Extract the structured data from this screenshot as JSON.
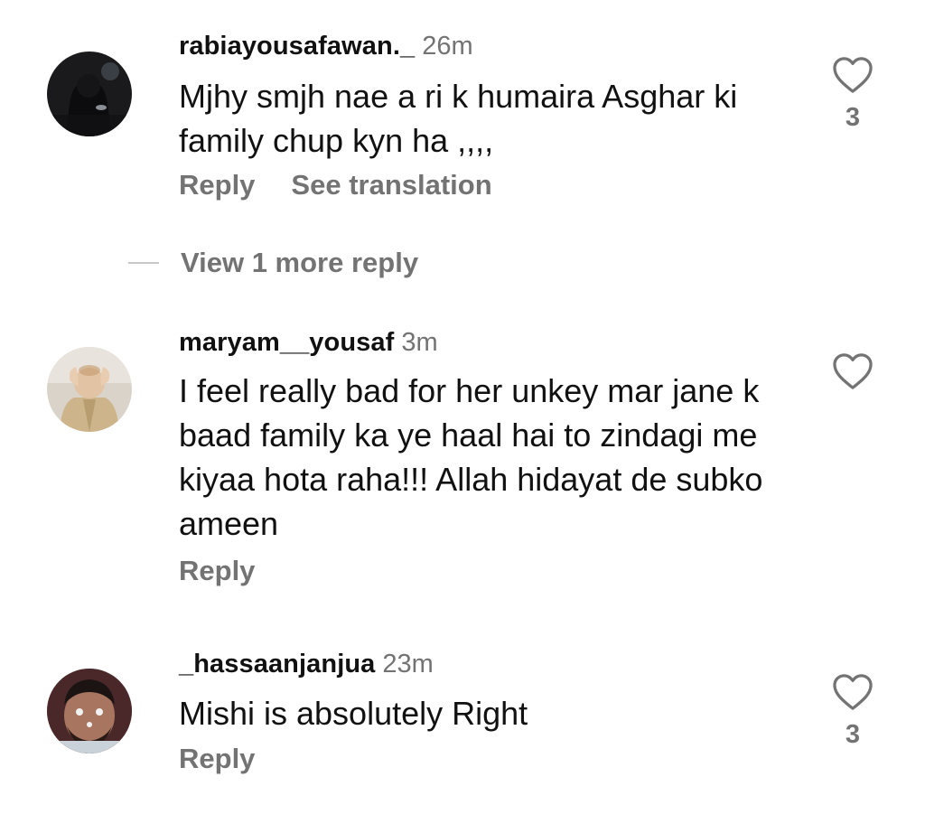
{
  "comments": [
    {
      "username": "rabiayousafawan._",
      "time": "26m",
      "text": "Mjhy smjh nae a ri k humaira Asghar ki family chup kyn ha ,,,,",
      "reply_label": "Reply",
      "translate_label": "See translation",
      "likes": "3"
    },
    {
      "username": "maryam__yousaf",
      "time": "3m",
      "text": "I feel really bad for her unkey mar jane k baad family ka ye haal hai to zindagi me kiyaa hota raha!!! Allah hidayat de subko ameen",
      "reply_label": "Reply"
    },
    {
      "username": "_hassaanjanjua",
      "time": "23m",
      "text": "Mishi is absolutely Right",
      "reply_label": "Reply",
      "likes": "3"
    }
  ],
  "view_replies_label": "View 1 more reply",
  "icons": {
    "like": "heart-outline-icon",
    "avatar": "avatar-photo"
  },
  "colors": {
    "text": "#111111",
    "muted": "#737373",
    "divider": "#c7c7c7",
    "background": "#ffffff"
  }
}
